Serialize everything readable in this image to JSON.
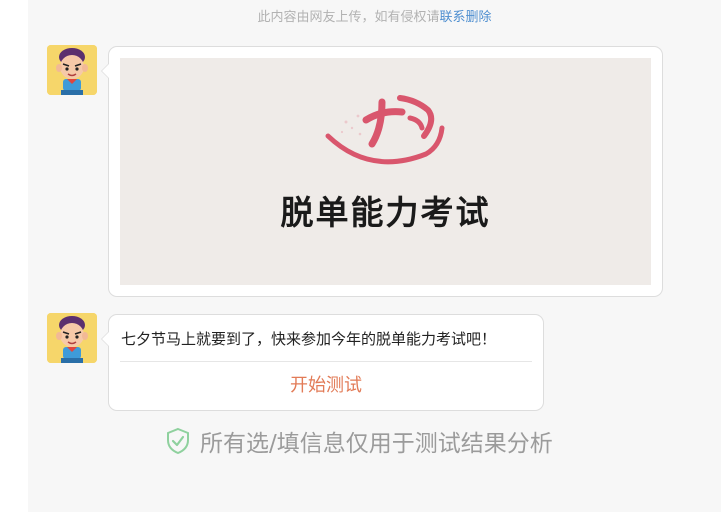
{
  "notice": {
    "text": "此内容由网友上传，如有侵权请",
    "link": "联系删除"
  },
  "messages": [
    {
      "poster": {
        "logo_text": "七夕",
        "title": "脱单能力考试"
      }
    },
    {
      "text": "七夕节马上就要到了，快来参加今年的脱单能力考试吧！",
      "button": "开始测试"
    }
  ],
  "footer": {
    "privacy_text": "所有选/填信息仅用于测试结果分析"
  },
  "colors": {
    "accent": "#e27b57",
    "link": "#4f8fd0",
    "shield": "#8fd19e",
    "logo": "#d9566d"
  },
  "icons": [
    "avatar-cartoon-boy",
    "shield-check-icon"
  ]
}
